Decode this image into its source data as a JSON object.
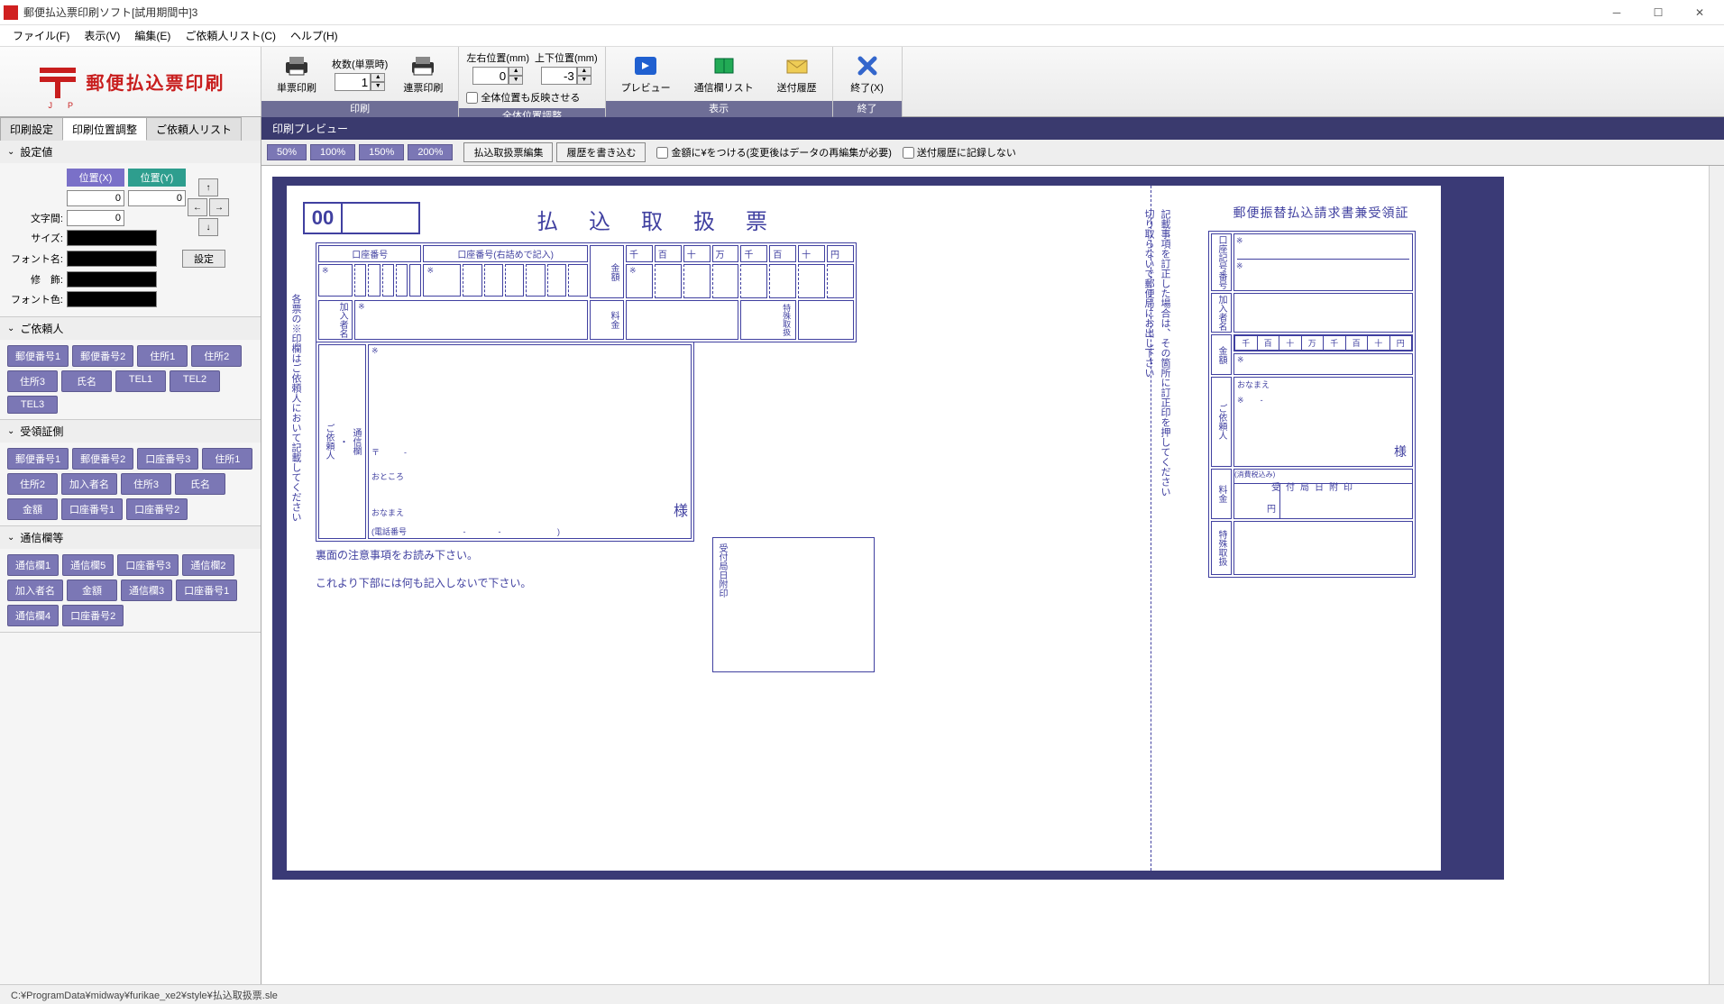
{
  "window": {
    "title": "郵便払込票印刷ソフト[試用期間中]3"
  },
  "menubar": [
    "ファイル(F)",
    "表示(V)",
    "編集(E)",
    "ご依頼人リスト(C)",
    "ヘルプ(H)"
  ],
  "logo": {
    "text": "郵便払込票印刷",
    "jp": "J　P"
  },
  "toolbar": {
    "print": {
      "single": "単票印刷",
      "sheets_label": "枚数(単票時)",
      "sheets_value": "1",
      "continuous": "連票印刷",
      "caption": "印刷"
    },
    "pos": {
      "lr_label": "左右位置(mm)",
      "lr_value": "0",
      "ud_label": "上下位置(mm)",
      "ud_value": "-3",
      "reflect": "全体位置も反映させる",
      "caption": "全体位置調整"
    },
    "display": {
      "preview": "プレビュー",
      "commlist": "通信欄リスト",
      "history": "送付履歴",
      "caption": "表示"
    },
    "exit": {
      "label": "終了(X)",
      "caption": "終了"
    }
  },
  "sidebar": {
    "tabs": [
      "印刷設定",
      "印刷位置調整",
      "ご依頼人リスト"
    ],
    "active_tab": 1,
    "settings": {
      "title": "設定値",
      "posx_head": "位置(X)",
      "posy_head": "位置(Y)",
      "posx": "0",
      "posy": "0",
      "spacing_label": "文字間:",
      "spacing": "0",
      "size_label": "サイズ:",
      "font_label": "フォント名:",
      "deco_label": "修　飾:",
      "color_label": "フォント色:",
      "set_btn": "設定"
    },
    "sec_requester": {
      "title": "ご依頼人",
      "chips": [
        "郵便番号1",
        "郵便番号2",
        "住所1",
        "住所2",
        "住所3",
        "氏名",
        "TEL1",
        "TEL2",
        "TEL3"
      ]
    },
    "sec_receipt": {
      "title": "受領証側",
      "chips": [
        "郵便番号1",
        "郵便番号2",
        "口座番号3",
        "住所1",
        "住所2",
        "加入者名",
        "住所3",
        "氏名",
        "金額",
        "口座番号1",
        "口座番号2"
      ]
    },
    "sec_comm": {
      "title": "通信欄等",
      "chips": [
        "通信欄1",
        "通信欄5",
        "口座番号3",
        "通信欄2",
        "加入者名",
        "金額",
        "通信欄3",
        "口座番号1",
        "通信欄4",
        "口座番号2"
      ]
    }
  },
  "preview": {
    "title": "印刷プレビュー",
    "zooms": [
      "50%",
      "100%",
      "150%",
      "200%"
    ],
    "btn_edit": "払込取扱票編集",
    "btn_history": "履歴を書き込む",
    "chk_yen": "金額に¥をつける(変更後はデータの再編集が必要)",
    "chk_norecord": "送付履歴に記録しない"
  },
  "form": {
    "main_title": "払込取扱票",
    "zero": "00",
    "acct_label": "口座番号",
    "acct_label2": "口座番号(右詰めで記入)",
    "amount_head": "金額",
    "fee_head": "料金",
    "digits": [
      "千",
      "百",
      "十",
      "万",
      "千",
      "百",
      "十",
      "円"
    ],
    "special": "特殊取扱",
    "subscriber": "加入者名",
    "comm": "通信欄",
    "requester": "ご依頼人",
    "left_vert": "各票の※印欄はご依頼人において記載してください",
    "mid_cut": "切り取らないで郵便局にお出し下さい",
    "mid_note": "記載事項を訂正した場合は、その箇所に訂正印を押してください",
    "furigana": "おなまえ",
    "addr_small": "おところ",
    "postmark": "〒",
    "sama": "様",
    "phone": "(電話番号",
    "phone_end": ")",
    "phone_dashes": "-　　　　-",
    "recv_office": "受付局日附印",
    "footer1": "裏面の注意事項をお読み下さい。",
    "footer2": "これより下部には何も記入しないで下さい。",
    "receipt_title": "郵便振替払込請求書兼受領証",
    "receipt_acct": "口座記号番号",
    "receipt_sub": "加入者名",
    "receipt_amount": "金額",
    "receipt_req": "ご依頼人",
    "receipt_fee": "料金",
    "receipt_yen": "円",
    "receipt_tax": "(消費税込み)",
    "receipt_special": "特殊取扱",
    "receipt_stamp": "受付局日附印",
    "star": "※",
    "dash": "-"
  },
  "status": {
    "path": "C:¥ProgramData¥midway¥furikae_xe2¥style¥払込取扱票.sle"
  }
}
